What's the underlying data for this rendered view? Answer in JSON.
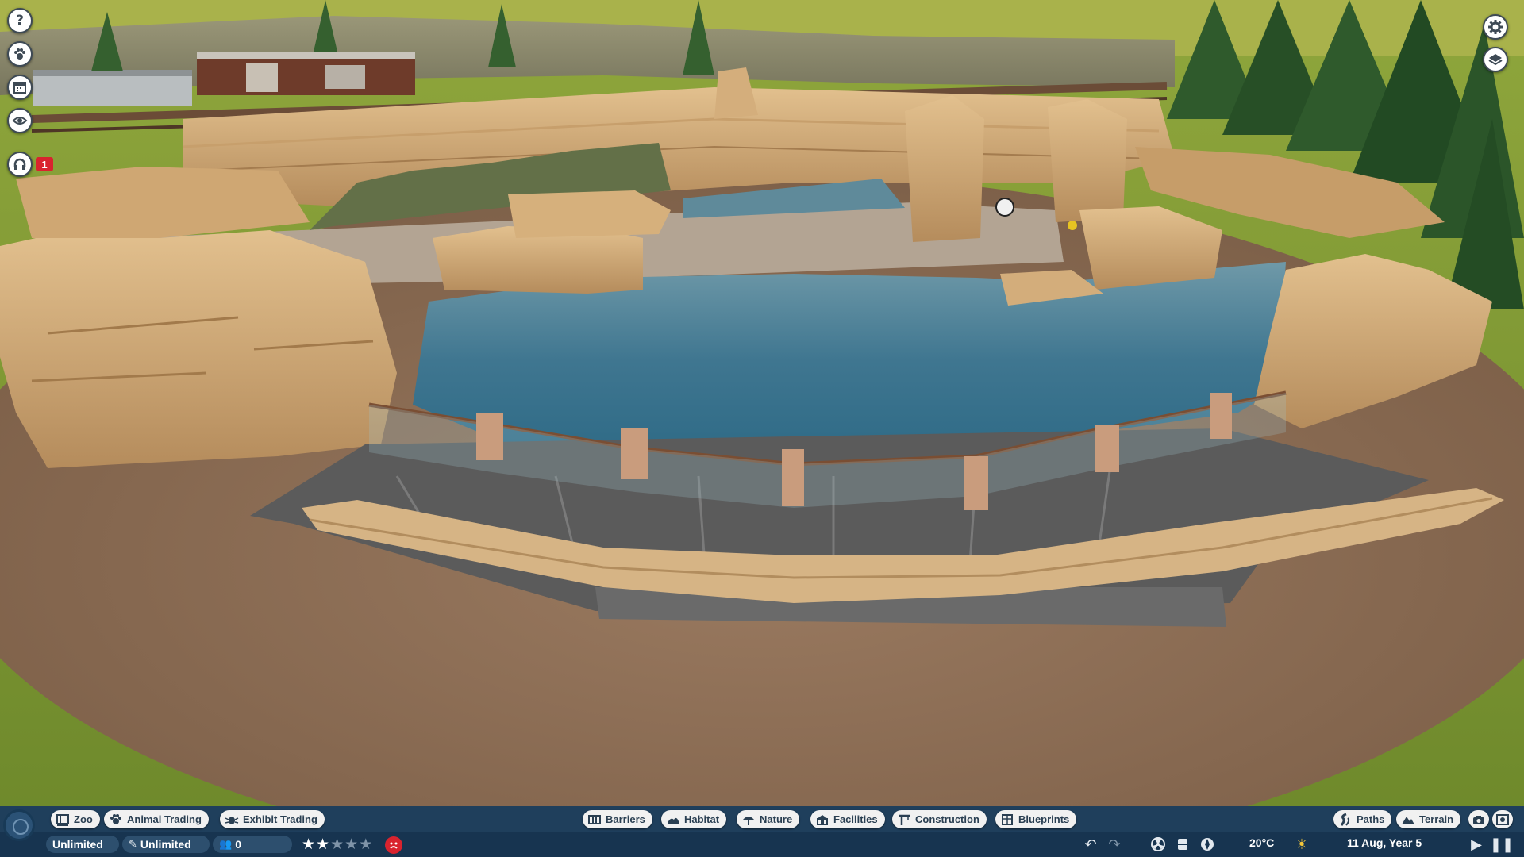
{
  "left_toolbar": {
    "items": [
      {
        "name": "help",
        "glyph": "?"
      },
      {
        "name": "animals"
      },
      {
        "name": "calendar"
      },
      {
        "name": "view"
      },
      {
        "name": "messages"
      }
    ],
    "notification_count": "1"
  },
  "right_toolbar": {
    "items": [
      {
        "name": "settings"
      },
      {
        "name": "layers"
      }
    ]
  },
  "menu_left": {
    "buttons": [
      {
        "label": "Zoo",
        "icon": "zoo-icon"
      },
      {
        "label": "Animal Trading",
        "icon": "paw-icon"
      },
      {
        "label": "Exhibit Trading",
        "icon": "bug-icon"
      }
    ]
  },
  "menu_center": {
    "buttons": [
      {
        "label": "Barriers",
        "icon": "barrier-icon"
      },
      {
        "label": "Habitat",
        "icon": "habitat-icon"
      },
      {
        "label": "Nature",
        "icon": "tree-icon"
      },
      {
        "label": "Facilities",
        "icon": "building-icon"
      },
      {
        "label": "Construction",
        "icon": "construction-icon"
      },
      {
        "label": "Blueprints",
        "icon": "blueprint-icon"
      }
    ]
  },
  "menu_right": {
    "buttons": [
      {
        "label": "Paths",
        "icon": "path-icon"
      },
      {
        "label": "Terrain",
        "icon": "terrain-icon"
      }
    ]
  },
  "status_bar": {
    "money": "Unlimited",
    "research": "Unlimited",
    "guests": "0",
    "rating_stars": 2,
    "rating_max": 5,
    "temperature": "20°C",
    "date": "11 Aug, Year 5"
  },
  "colors": {
    "hud_top": "#1f3f5c",
    "hud_bottom": "#173450",
    "button_bg": "#f1f1f1",
    "button_text": "#2a3f52",
    "alert_red": "#d9232e",
    "star_filled": "#ffffff",
    "star_empty": "#7f94a8"
  }
}
